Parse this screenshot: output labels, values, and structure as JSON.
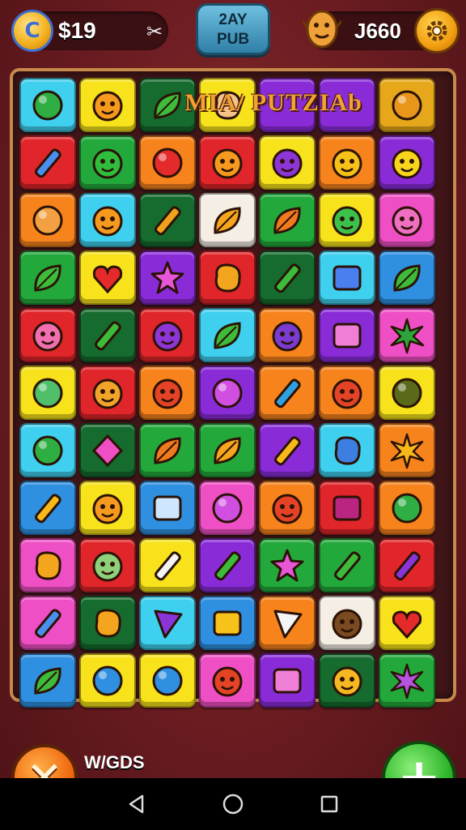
{
  "hud": {
    "coins": "$19",
    "coin_symbol": "C",
    "tools_symbol": "✂",
    "day_badge": {
      "line1": "2AY",
      "line2": "PUB"
    },
    "score": "J660"
  },
  "title": "MIA/ PUTZIAb",
  "tile_colors": {
    "cyan": "#3fd0ef",
    "yellow": "#f7e21b",
    "green": "#23a93b",
    "dkgreen": "#166b2e",
    "orange": "#f7831c",
    "red": "#e0262a",
    "purple": "#8a2bd8",
    "pink": "#ef4fc4",
    "blue": "#2f8fe0",
    "white": "#f4eee4",
    "gold": "#e6a81a"
  },
  "board": {
    "rows": [
      [
        [
          "cyan",
          "green-orb-icon"
        ],
        [
          "yellow",
          "sun-face-icon"
        ],
        [
          "dkgreen",
          "leaf-icon"
        ],
        [
          "yellow",
          "hand-icon"
        ],
        [
          "purple",
          "blank-icon"
        ],
        [
          "purple",
          "blank-icon"
        ],
        [
          "gold",
          "fruit-icon"
        ]
      ],
      [
        [
          "red",
          "rocket-icon"
        ],
        [
          "green",
          "frog-face-icon"
        ],
        [
          "orange",
          "apple-icon"
        ],
        [
          "red",
          "sun-face-icon"
        ],
        [
          "yellow",
          "cat-face-icon"
        ],
        [
          "orange",
          "robot-face-icon"
        ],
        [
          "purple",
          "lemon-face-icon"
        ]
      ],
      [
        [
          "orange",
          "snail-icon"
        ],
        [
          "cyan",
          "sun-face-icon"
        ],
        [
          "dkgreen",
          "pen-icon"
        ],
        [
          "white",
          "bird-icon"
        ],
        [
          "green",
          "carrot-icon"
        ],
        [
          "yellow",
          "chameleon-icon"
        ],
        [
          "pink",
          "blob-face-icon"
        ]
      ],
      [
        [
          "green",
          "leaf-icon"
        ],
        [
          "yellow",
          "heart-icon"
        ],
        [
          "purple",
          "star-icon"
        ],
        [
          "red",
          "blob-icon"
        ],
        [
          "dkgreen",
          "crayon-icon"
        ],
        [
          "cyan",
          "book-icon"
        ],
        [
          "blue",
          "leaf-icon"
        ]
      ],
      [
        [
          "red",
          "pig-face-icon"
        ],
        [
          "dkgreen",
          "crayon-icon"
        ],
        [
          "red",
          "cat-face-icon"
        ],
        [
          "cyan",
          "leaf-icon"
        ],
        [
          "orange",
          "bug-icon"
        ],
        [
          "purple",
          "pillow-icon"
        ],
        [
          "pink",
          "plant-icon"
        ]
      ],
      [
        [
          "yellow",
          "button-icon"
        ],
        [
          "red",
          "lion-face-icon"
        ],
        [
          "orange",
          "monster-face-icon"
        ],
        [
          "purple",
          "swirl-icon"
        ],
        [
          "orange",
          "cross-icon"
        ],
        [
          "orange",
          "monster-face-icon"
        ],
        [
          "yellow",
          "nut-icon"
        ]
      ],
      [
        [
          "cyan",
          "green-orb-icon"
        ],
        [
          "dkgreen",
          "gem-icon"
        ],
        [
          "green",
          "carrot-icon"
        ],
        [
          "green",
          "bird-icon"
        ],
        [
          "purple",
          "pencil-icon"
        ],
        [
          "cyan",
          "fish-icon"
        ],
        [
          "orange",
          "burst-icon"
        ]
      ],
      [
        [
          "blue",
          "pencil-icon"
        ],
        [
          "yellow",
          "sun-face-icon"
        ],
        [
          "blue",
          "board-icon"
        ],
        [
          "pink",
          "swirl-icon"
        ],
        [
          "orange",
          "monster-face-icon"
        ],
        [
          "red",
          "box-icon"
        ],
        [
          "orange",
          "green-orb-icon"
        ]
      ],
      [
        [
          "pink",
          "blob-icon"
        ],
        [
          "red",
          "zombie-face-icon"
        ],
        [
          "yellow",
          "wand-icon"
        ],
        [
          "purple",
          "crayon-icon"
        ],
        [
          "green",
          "star-icon"
        ],
        [
          "green",
          "crayon-icon"
        ],
        [
          "red",
          "bottle-icon"
        ]
      ],
      [
        [
          "pink",
          "rocket-icon"
        ],
        [
          "dkgreen",
          "blob-icon"
        ],
        [
          "cyan",
          "triangle-icon"
        ],
        [
          "blue",
          "letter-p-icon"
        ],
        [
          "orange",
          "plane-icon"
        ],
        [
          "white",
          "bear-icon"
        ],
        [
          "yellow",
          "heart-icon"
        ]
      ],
      [
        [
          "blue",
          "leaf-icon"
        ],
        [
          "yellow",
          "blue-orb-icon"
        ],
        [
          "yellow",
          "blue-orb-icon"
        ],
        [
          "pink",
          "monster-face-icon"
        ],
        [
          "purple",
          "pillow-icon"
        ],
        [
          "dkgreen",
          "chick-icon"
        ],
        [
          "green",
          "flower-icon"
        ]
      ]
    ]
  },
  "footer": {
    "close_symbol": "✕",
    "words_label": "W/GDS",
    "add_symbol": "+"
  }
}
